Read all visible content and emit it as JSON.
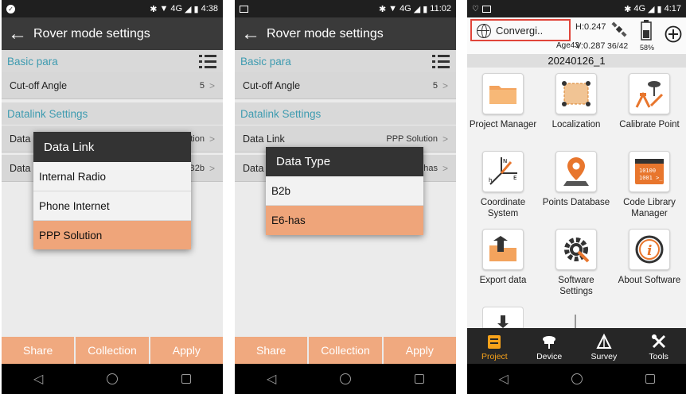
{
  "screen1": {
    "status_time": "4:38",
    "status_signal": "4G",
    "app_title": "Rover mode settings",
    "section_basic": "Basic para",
    "row_cutoff_label": "Cut-off Angle",
    "row_cutoff_value": "5",
    "section_datalink": "Datalink Settings",
    "row1_label": "Data",
    "row1_value": "tion",
    "row2_label": "Data",
    "row2_value": "B2b",
    "dialog_title": "Data Link",
    "dialog_options": [
      "Internal Radio",
      "Phone Internet",
      "PPP Solution"
    ],
    "selected_option": "PPP Solution",
    "buttons": [
      "Share",
      "Collection",
      "Apply"
    ]
  },
  "screen2": {
    "status_time": "11:02",
    "status_signal": "4G",
    "app_title": "Rover mode settings",
    "section_basic": "Basic para",
    "row_cutoff_label": "Cut-off Angle",
    "row_cutoff_value": "5",
    "section_datalink": "Datalink Settings",
    "row_datalink_label": "Data Link",
    "row_datalink_value": "PPP Solution",
    "row2_label": "Data",
    "row2_value": "has",
    "dialog_title": "Data Type",
    "dialog_options": [
      "B2b",
      "E6-has"
    ],
    "selected_option": "E6-has",
    "buttons": [
      "Share",
      "Collection",
      "Apply"
    ]
  },
  "screen3": {
    "status_time": "4:17",
    "status_signal": "4G",
    "status_battery": "58%",
    "converge_label": "Convergi..",
    "h_value": "H:0.247",
    "v_value": "V:0.287",
    "age_value": "Age43",
    "sat_value": "36/42",
    "battery_pct": "58%",
    "project_name": "20240126_1",
    "tiles": [
      {
        "label": "Project Manager",
        "icon": "folder-icon"
      },
      {
        "label": "Localization",
        "icon": "localization-icon"
      },
      {
        "label": "Calibrate Point",
        "icon": "calibrate-point-icon"
      },
      {
        "label": "Coordinate System",
        "icon": "coordinate-system-icon"
      },
      {
        "label": "Points Database",
        "icon": "points-database-icon"
      },
      {
        "label": "Code Library Manager",
        "icon": "code-library-icon"
      },
      {
        "label": "Export data",
        "icon": "export-data-icon"
      },
      {
        "label": "Software Settings",
        "icon": "settings-gear-icon"
      },
      {
        "label": "About Software",
        "icon": "info-icon"
      }
    ],
    "bottom_nav": [
      "Project",
      "Device",
      "Survey",
      "Tools"
    ],
    "active_tab": "Project"
  },
  "colors": {
    "accent_orange": "#f0a97f",
    "selected_option": "#efa57a",
    "section_text": "#3e9bb0",
    "active_nav": "#f7a21a",
    "converge_border": "#e0453a"
  }
}
